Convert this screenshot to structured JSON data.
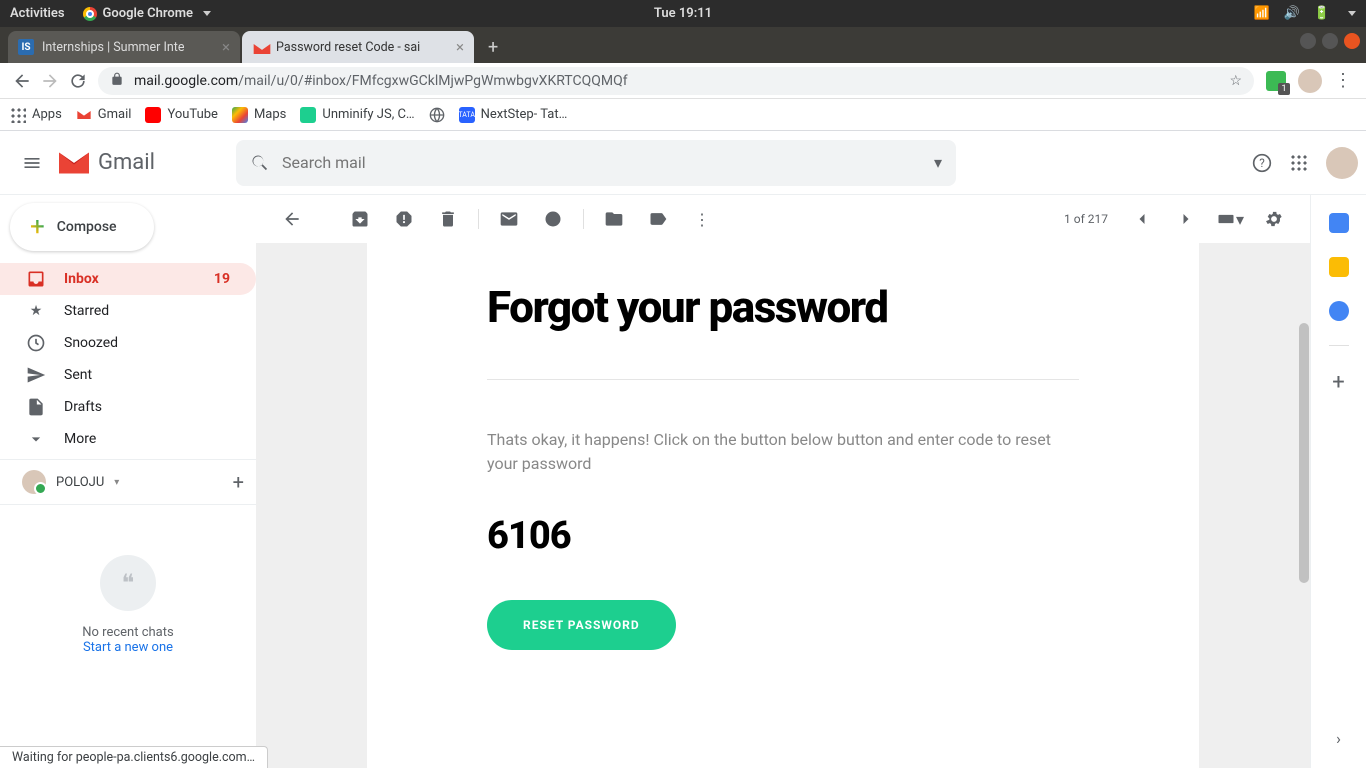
{
  "ubuntu": {
    "activities": "Activities",
    "app": "Google Chrome",
    "clock": "Tue 19:11"
  },
  "tabs": [
    {
      "title": "Internships | Summer Inte"
    },
    {
      "title": "Password reset Code - sai"
    }
  ],
  "addr": {
    "host": "mail.google.com",
    "path": "/mail/u/0/#inbox/FMfcgxwGCklMjwPgWmwbgvXKRTCQQMQf"
  },
  "bookmarks": {
    "apps": "Apps",
    "gmail": "Gmail",
    "youtube": "YouTube",
    "maps": "Maps",
    "unminify": "Unminify JS, C…",
    "nextstep": "NextStep- Tat…"
  },
  "gmail": {
    "brand": "Gmail",
    "search_placeholder": "Search mail",
    "compose": "Compose",
    "nav": {
      "inbox": "Inbox",
      "inbox_count": "19",
      "starred": "Starred",
      "snoozed": "Snoozed",
      "sent": "Sent",
      "drafts": "Drafts",
      "more": "More"
    },
    "label_user": "POLOJU",
    "hangouts_line1": "No recent chats",
    "hangouts_line2": "Start a new one",
    "pagination": "1 of 217"
  },
  "email": {
    "heading": "Forgot your password",
    "body": "Thats okay, it happens! Click on the button below button and enter code to reset your password",
    "code": "6106",
    "button": "RESET PASSWORD"
  },
  "status": "Waiting for people-pa.clients6.google.com…"
}
